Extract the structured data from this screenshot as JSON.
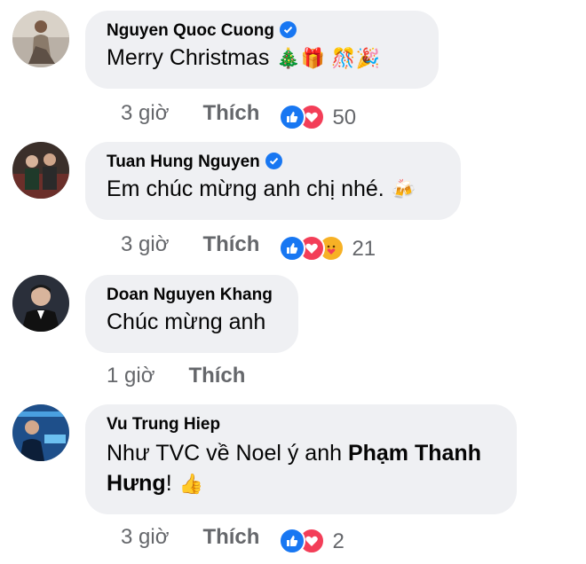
{
  "comments": [
    {
      "name": "Nguyen Quoc Cuong",
      "verified": true,
      "text": "Merry Christmas",
      "emojis": "🎄🎁 🎊🎉",
      "time": "3 giờ",
      "like_label": "Thích",
      "reactions": [
        "like",
        "love"
      ],
      "reaction_count": "50"
    },
    {
      "name": "Tuan Hung Nguyen",
      "verified": true,
      "text": "Em chúc mừng anh chị nhé.",
      "emojis": "🍻",
      "time": "3 giờ",
      "like_label": "Thích",
      "reactions": [
        "like",
        "love",
        "care"
      ],
      "reaction_count": "21"
    },
    {
      "name": "Doan Nguyen Khang",
      "verified": false,
      "text": "Chúc mừng anh",
      "time": "1 giờ",
      "like_label": "Thích"
    },
    {
      "name": "Vu Trung Hiep",
      "verified": false,
      "text_before": "Như TVC về Noel ý anh ",
      "mention": "Phạm Thanh Hưng",
      "text_after": "!",
      "emojis": "👍",
      "time": "3 giờ",
      "like_label": "Thích",
      "reactions": [
        "like",
        "love"
      ],
      "reaction_count": "2"
    }
  ],
  "colors": {
    "bubble": "#eff0f3",
    "meta_text": "#65676b",
    "verified": "#1877f2",
    "like_reaction": "#1877f2",
    "love_reaction": "#f33e58",
    "care_reaction": "#f7b125"
  }
}
